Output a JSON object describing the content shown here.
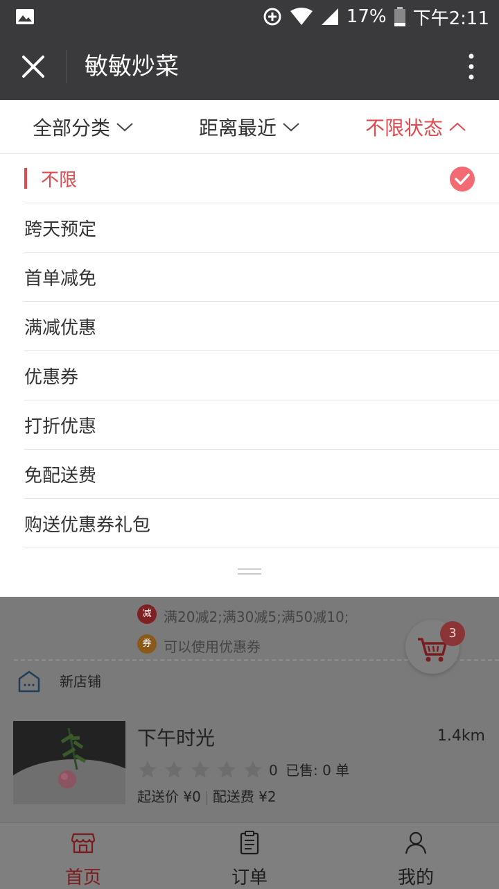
{
  "status_bar": {
    "battery": "17%",
    "time": "下午2:11"
  },
  "nav": {
    "title": "敏敏炒菜"
  },
  "filters": [
    {
      "label": "全部分类",
      "active": false
    },
    {
      "label": "距离最近",
      "active": false
    },
    {
      "label": "不限状态",
      "active": true
    }
  ],
  "options": [
    {
      "label": "不限",
      "selected": true
    },
    {
      "label": "跨天预定",
      "selected": false
    },
    {
      "label": "首单减免",
      "selected": false
    },
    {
      "label": "满减优惠",
      "selected": false
    },
    {
      "label": "优惠券",
      "selected": false
    },
    {
      "label": "打折优惠",
      "selected": false
    },
    {
      "label": "免配送费",
      "selected": false
    },
    {
      "label": "购送优惠券礼包",
      "selected": false
    }
  ],
  "background": {
    "promo_discount_badge": "减",
    "promo_discount_text": "满20减2;满30减5;满50减10;",
    "promo_coupon_badge": "券",
    "promo_coupon_text": "可以使用优惠券",
    "store_section_label": "新店铺",
    "shop": {
      "name": "下午时光",
      "distance": "1.4km",
      "rating": "0",
      "sold": "已售: 0 单",
      "min_order": "起送价 ¥0",
      "delivery_fee": "配送费 ¥2"
    },
    "cart_count": "3"
  },
  "tabs": [
    {
      "label": "首页",
      "active": true
    },
    {
      "label": "订单",
      "active": false
    },
    {
      "label": "我的",
      "active": false
    }
  ],
  "colors": {
    "accent": "#e04a4f",
    "nav_bg": "#3a3a3c",
    "check": "#f26b72"
  }
}
